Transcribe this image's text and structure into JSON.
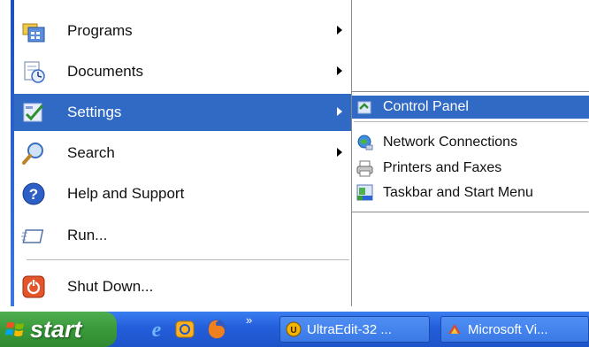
{
  "start_menu": {
    "items": [
      {
        "label": "Programs",
        "icon": "programs-icon",
        "submenu": true
      },
      {
        "label": "Documents",
        "icon": "documents-icon",
        "submenu": true
      },
      {
        "label": "Settings",
        "icon": "settings-icon",
        "submenu": true,
        "selected": true
      },
      {
        "label": "Search",
        "icon": "search-icon",
        "submenu": true
      },
      {
        "label": "Help and Support",
        "icon": "help-icon",
        "submenu": false
      },
      {
        "label": "Run...",
        "icon": "run-icon",
        "submenu": false
      }
    ],
    "shutdown": {
      "label": "Shut Down...",
      "icon": "power-icon"
    }
  },
  "settings_submenu": {
    "items": [
      {
        "label": "Control Panel",
        "icon": "control-panel-icon",
        "selected": true
      },
      {
        "label": "Network Connections",
        "icon": "network-icon"
      },
      {
        "label": "Printers and Faxes",
        "icon": "printer-icon"
      },
      {
        "label": "Taskbar and Start Menu",
        "icon": "taskbar-icon"
      }
    ]
  },
  "taskbar": {
    "start_label": "start",
    "quick_launch_overflow": "»",
    "tasks": [
      {
        "label": "UltraEdit-32 ...",
        "icon": "ultraedit-icon"
      },
      {
        "label": "Microsoft Vi...",
        "icon": "visual-studio-icon"
      }
    ]
  },
  "colors": {
    "selection": "#316ac5",
    "taskbar": "#245edb",
    "start_button": "#3a9a3a"
  }
}
